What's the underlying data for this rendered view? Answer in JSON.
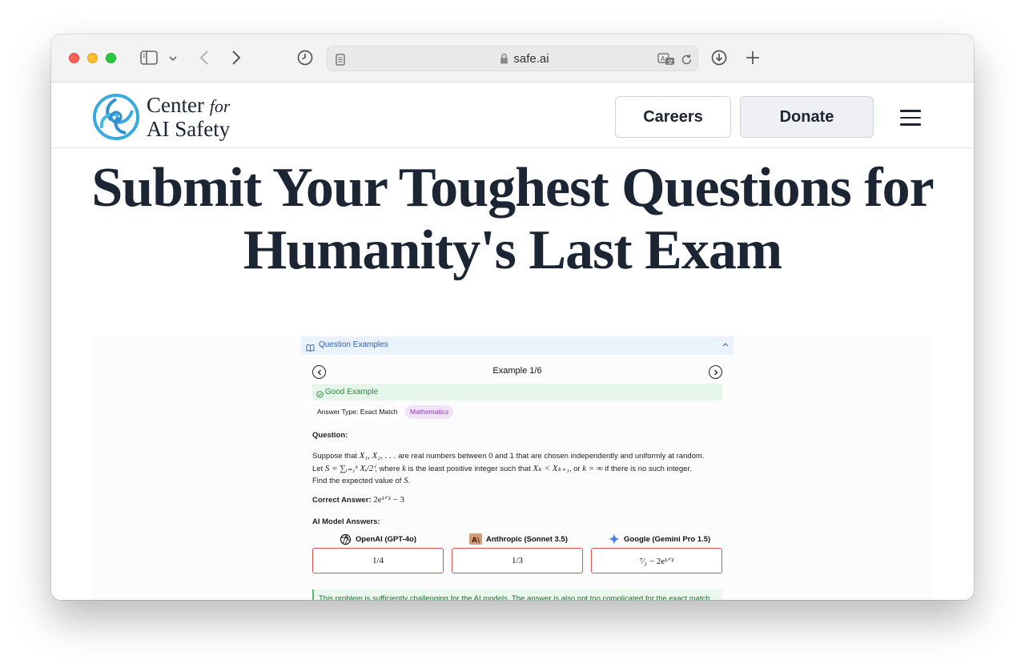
{
  "browser": {
    "url": "safe.ai"
  },
  "site": {
    "logo_line1": "Center",
    "logo_for": "for",
    "logo_line2": "AI Safety",
    "careers_label": "Careers",
    "donate_label": "Donate"
  },
  "hero": {
    "line1": "Submit Your Toughest Questions for",
    "line2": "Humanity's Last Exam"
  },
  "examples": {
    "section_label": "Question Examples",
    "counter": "Example 1/6",
    "quality": "Good Example",
    "answer_type": "Answer Type: Exact Match",
    "subject": "Mathematics",
    "question_heading": "Question:",
    "question_line1_pre": "Suppose that",
    "question_line1_math": "X₁, X₂, . . .",
    "question_line1_post": "are real numbers between 0 and 1 that are chosen independently and uniformly at random.",
    "question_line2_pre": "Let",
    "question_line2_math1": "S = ∑ᵢ₌₁ᵏ Xᵢ/2ⁱ",
    "question_line2_mid1": ", where",
    "question_line2_math2": "k",
    "question_line2_mid2": "is the least positive integer such that",
    "question_line2_math3": "Xₖ < Xₖ₊₁",
    "question_line2_mid3": ", or",
    "question_line2_math4": "k = ∞",
    "question_line2_post": "if there is no such integer.",
    "question_line3_pre": "Find the expected value of",
    "question_line3_math": "S",
    "question_line3_post": ".",
    "correct_label": "Correct Answer:",
    "correct_value": "2e¹ᐟ² − 3",
    "models_heading": "AI Model Answers:",
    "models": [
      {
        "name": "OpenAI (GPT-4o)",
        "answer": "1/4",
        "icon": "openai-icon"
      },
      {
        "name": "Anthropic (Sonnet 3.5)",
        "answer": "1/3",
        "icon": "anthropic-icon"
      },
      {
        "name": "Google (Gemini Pro 1.5)",
        "answer": "⁷⁄₂ − 2e¹ᐟ²",
        "icon": "gemini-icon"
      }
    ],
    "note": "This problem is sufficiently challenging for the AI models. The answer is also not too complicated for the exact match format."
  },
  "colors": {
    "text_dark": "#1c2534",
    "wrong_border": "#d9534f",
    "good_green": "#2a8a3c",
    "subject_purple": "#8a3aa8"
  }
}
